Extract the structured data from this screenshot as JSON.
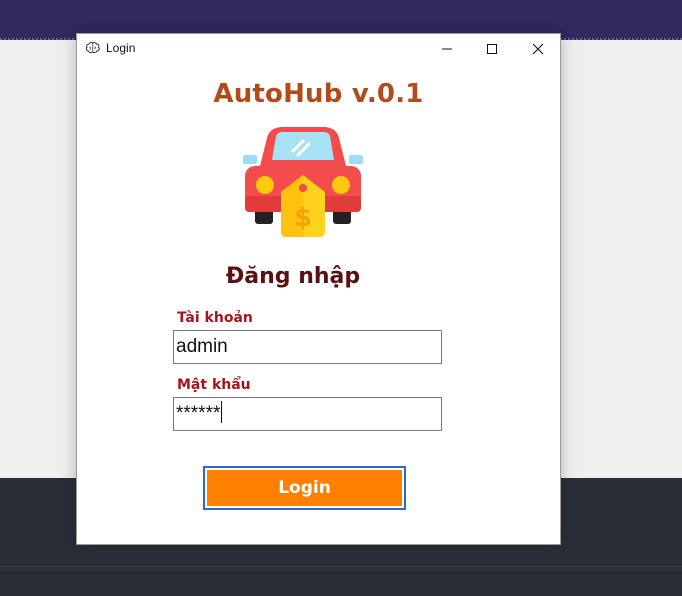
{
  "window": {
    "title": "Login"
  },
  "app": {
    "name": "AutoHub v.0.1"
  },
  "form": {
    "title": "Đăng nhập",
    "username_label": "Tài khoản",
    "username_value": "admin",
    "password_label": "Mật khẩu",
    "password_value": "******",
    "login_label": "Login"
  },
  "icons": {
    "window": "brain-icon",
    "minimize": "minimize-icon",
    "maximize": "maximize-icon",
    "close": "close-icon",
    "logo": "car-price-tag-icon"
  },
  "colors": {
    "brand": "#b24a1a",
    "section_title": "#5a1010",
    "field_label": "#a8141a",
    "login_button": "#ff8000",
    "button_border": "#2b6bd0",
    "car_body": "#f24c4c",
    "price_tag": "#ffd21f"
  }
}
